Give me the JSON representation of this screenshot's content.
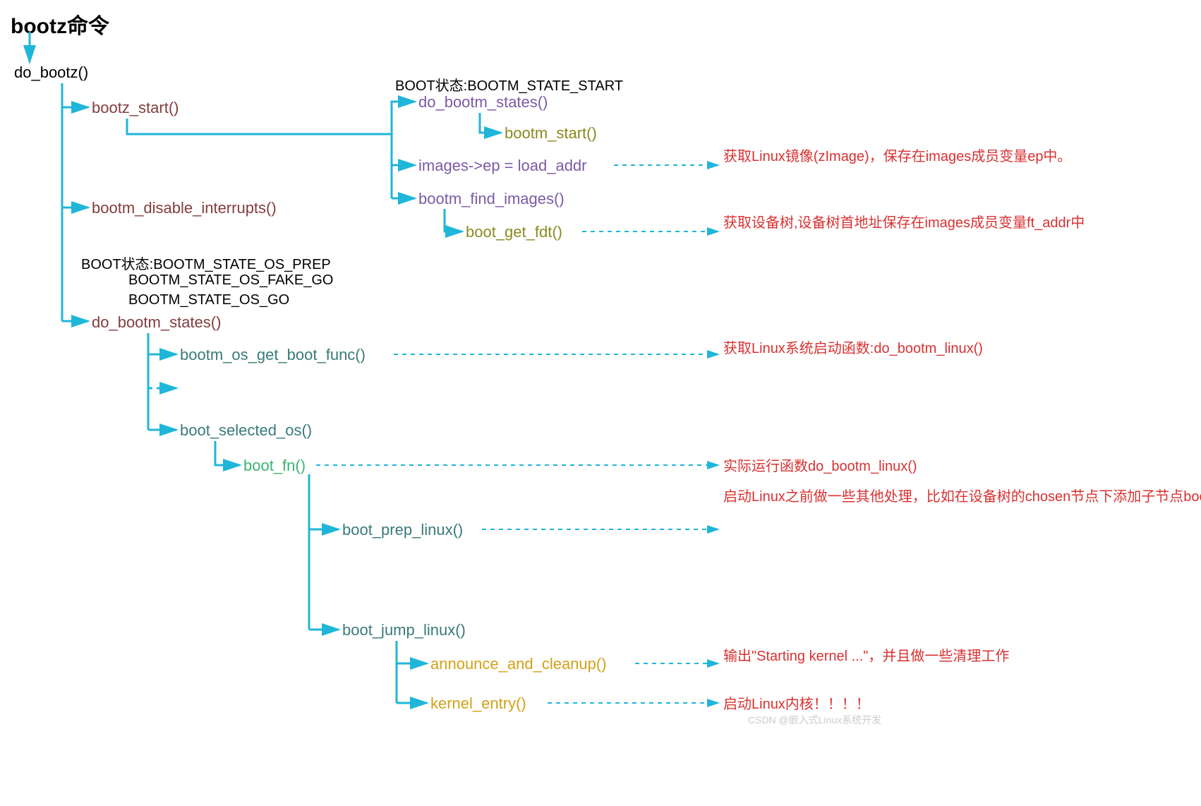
{
  "title": "bootz命令",
  "nodes": {
    "do_bootz": "do_bootz()",
    "bootz_start": "bootz_start()",
    "bootm_disable_interrupts": "bootm_disable_interrupts()",
    "do_bootm_states2": "do_bootm_states()",
    "state_start": "BOOT状态:BOOTM_STATE_START",
    "do_bootm_states1": "do_bootm_states()",
    "bootm_start": "bootm_start()",
    "images_ep": "images->ep = load_addr",
    "bootm_find_images": "bootm_find_images()",
    "boot_get_fdt": "boot_get_fdt()",
    "state_os_prep": "BOOT状态:BOOTM_STATE_OS_PREP",
    "state_os_fake_go": "BOOTM_STATE_OS_FAKE_GO",
    "state_os_go": "BOOTM_STATE_OS_GO",
    "bootm_os_get_boot_func": "bootm_os_get_boot_func()",
    "boot_selected_os": "boot_selected_os()",
    "boot_fn": "boot_fn()",
    "boot_prep_linux": "boot_prep_linux()",
    "boot_jump_linux": "boot_jump_linux()",
    "announce_and_cleanup": "announce_and_cleanup()",
    "kernel_entry": "kernel_entry()"
  },
  "annotations": {
    "a1": "获取Linux镜像(zImage)，保存在images成员变量ep中。",
    "a2": "获取设备树,设备树首地址保存在images成员变量ft_addr中",
    "a3": "获取Linux系统启动函数:do_bootm_linux()",
    "a4": "实际运行函数do_bootm_linux()",
    "a5": "启动Linux之前做一些其他处理，比如在设备树的chosen节点下添加子节点bootargs，bootargs子节点存放bootargs环境变量",
    "a6": "输出\"Starting kernel ...\"，并且做一些清理工作",
    "a7": "启动Linux内核！！！！"
  },
  "watermark": "CSDN @嵌入式Linux系统开发"
}
